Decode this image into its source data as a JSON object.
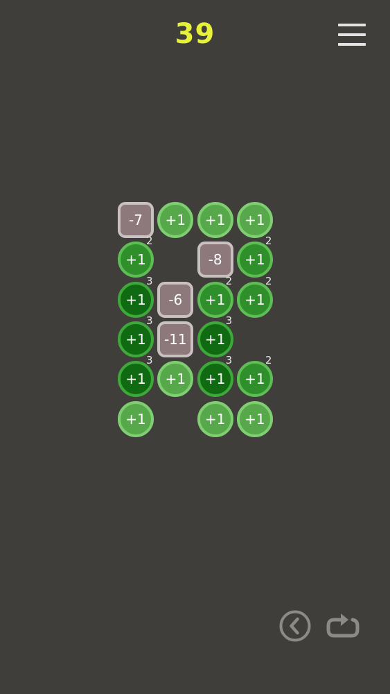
{
  "score": "39",
  "icons": {
    "menu": "hamburger-menu-icon",
    "undo": "back-arrow-circle-icon",
    "restart": "restart-loop-icon"
  },
  "colors": {
    "background": "#403e3b",
    "score": "#e6f23a",
    "tile_light": "#57a84b",
    "tile_mid": "#2f8f2b",
    "tile_dark": "#0f6a11",
    "tile_negative": "#8d797b"
  },
  "tiles": [
    {
      "row": 0,
      "col": 0,
      "label": "-7",
      "kind": "minus"
    },
    {
      "row": 0,
      "col": 1,
      "label": "+1",
      "kind": "light"
    },
    {
      "row": 0,
      "col": 2,
      "label": "+1",
      "kind": "light"
    },
    {
      "row": 0,
      "col": 3,
      "label": "+1",
      "kind": "light"
    },
    {
      "row": 1,
      "col": 0,
      "label": "+1",
      "kind": "mid",
      "count": "2"
    },
    {
      "row": 1,
      "col": 2,
      "label": "-8",
      "kind": "minus"
    },
    {
      "row": 1,
      "col": 3,
      "label": "+1",
      "kind": "mid",
      "count": "2"
    },
    {
      "row": 2,
      "col": 0,
      "label": "+1",
      "kind": "dark",
      "count": "3"
    },
    {
      "row": 2,
      "col": 1,
      "label": "-6",
      "kind": "minus"
    },
    {
      "row": 2,
      "col": 2,
      "label": "+1",
      "kind": "mid",
      "count": "2"
    },
    {
      "row": 2,
      "col": 3,
      "label": "+1",
      "kind": "mid",
      "count": "2"
    },
    {
      "row": 3,
      "col": 0,
      "label": "+1",
      "kind": "dark",
      "count": "3"
    },
    {
      "row": 3,
      "col": 1,
      "label": "-11",
      "kind": "minus"
    },
    {
      "row": 3,
      "col": 2,
      "label": "+1",
      "kind": "dark",
      "count": "3"
    },
    {
      "row": 4,
      "col": 0,
      "label": "+1",
      "kind": "dark",
      "count": "3"
    },
    {
      "row": 4,
      "col": 1,
      "label": "+1",
      "kind": "light"
    },
    {
      "row": 4,
      "col": 2,
      "label": "+1",
      "kind": "dark",
      "count": "3"
    },
    {
      "row": 4,
      "col": 3,
      "label": "+1",
      "kind": "mid",
      "count": "2"
    },
    {
      "row": 5,
      "col": 0,
      "label": "+1",
      "kind": "light"
    },
    {
      "row": 5,
      "col": 2,
      "label": "+1",
      "kind": "light"
    },
    {
      "row": 5,
      "col": 3,
      "label": "+1",
      "kind": "light"
    }
  ]
}
